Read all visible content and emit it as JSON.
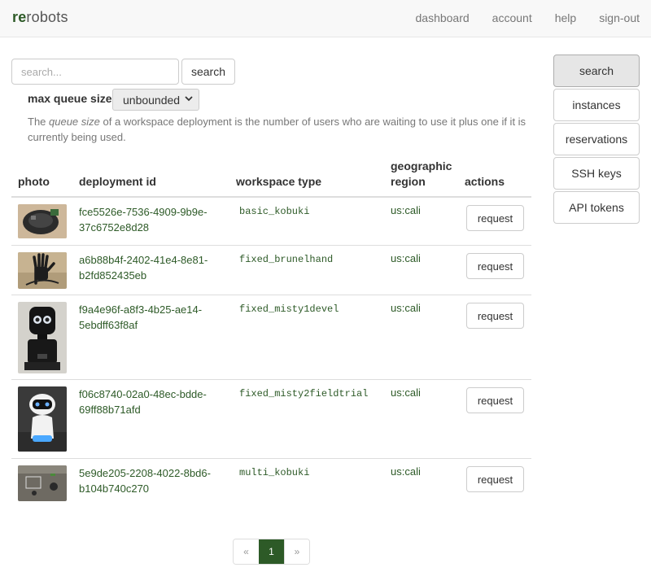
{
  "navbar": {
    "brand_bold": "re",
    "brand_rest": "robots",
    "links": [
      "dashboard",
      "account",
      "help",
      "sign-out"
    ]
  },
  "search": {
    "placeholder": "search...",
    "button_label": "search"
  },
  "max_queue": {
    "label": "max queue size",
    "selected": "unbounded"
  },
  "help_text": {
    "prefix": "The ",
    "emphasis": "queue size",
    "suffix": " of a workspace deployment is the number of users who are waiting to use it plus one if it is currently being used."
  },
  "table": {
    "headers": {
      "photo": "photo",
      "deployment_id": "deployment id",
      "workspace_type": "workspace type",
      "region": "geographic region",
      "actions": "actions"
    },
    "rows": [
      {
        "deployment_id": "fce5526e-7536-4909-9b9e-37c6752e8d28",
        "workspace_type": "basic_kobuki",
        "region": "us:cali",
        "action": "request"
      },
      {
        "deployment_id": "a6b88b4f-2402-41e4-8e81-b2fd852435eb",
        "workspace_type": "fixed_brunelhand",
        "region": "us:cali",
        "action": "request"
      },
      {
        "deployment_id": "f9a4e96f-a8f3-4b25-ae14-5ebdff63f8af",
        "workspace_type": "fixed_misty1devel",
        "region": "us:cali",
        "action": "request"
      },
      {
        "deployment_id": "f06c8740-02a0-48ec-bdde-69ff88b71afd",
        "workspace_type": "fixed_misty2fieldtrial",
        "region": "us:cali",
        "action": "request"
      },
      {
        "deployment_id": "5e9de205-2208-4022-8bd6-b104b740c270",
        "workspace_type": "multi_kobuki",
        "region": "us:cali",
        "action": "request"
      }
    ]
  },
  "sidebar": {
    "items": [
      "search",
      "instances",
      "reservations",
      "SSH keys",
      "API tokens"
    ],
    "active": "search"
  },
  "pagination": {
    "prev": "«",
    "current": "1",
    "next": "»"
  },
  "colors": {
    "brand": "#2d5a27",
    "navbar_bg": "#f8f8f8",
    "muted_text": "#777777"
  },
  "icons": [
    "chevron-down-icon"
  ]
}
